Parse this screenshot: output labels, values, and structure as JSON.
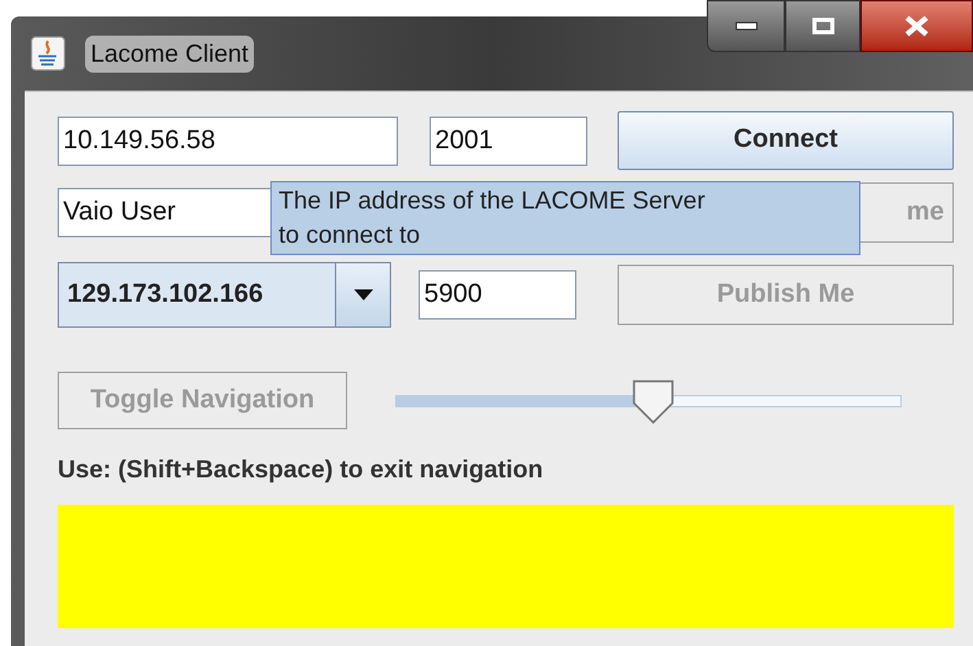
{
  "window": {
    "title": "Lacome Client"
  },
  "server_ip": {
    "value": "10.149.56.58"
  },
  "server_port": {
    "value": "2001"
  },
  "connect_button": {
    "label": "Connect",
    "disabled": false
  },
  "user_name": {
    "value": "Vaio User"
  },
  "name_button": {
    "label": "me",
    "disabled": true
  },
  "tooltip": {
    "lines": [
      "The IP address of the LACOME Server",
      "to connect to"
    ]
  },
  "address_combo": {
    "value": "129.173.102.166"
  },
  "vnc_port": {
    "value": "5900"
  },
  "publish_button": {
    "label": "Publish Me",
    "disabled": true
  },
  "navigation_button": {
    "label": "Toggle Navigation",
    "disabled": true
  },
  "zoom_slider": {
    "level": 0.51
  },
  "hint": "Use: (Shift+Backspace) to exit navigation"
}
